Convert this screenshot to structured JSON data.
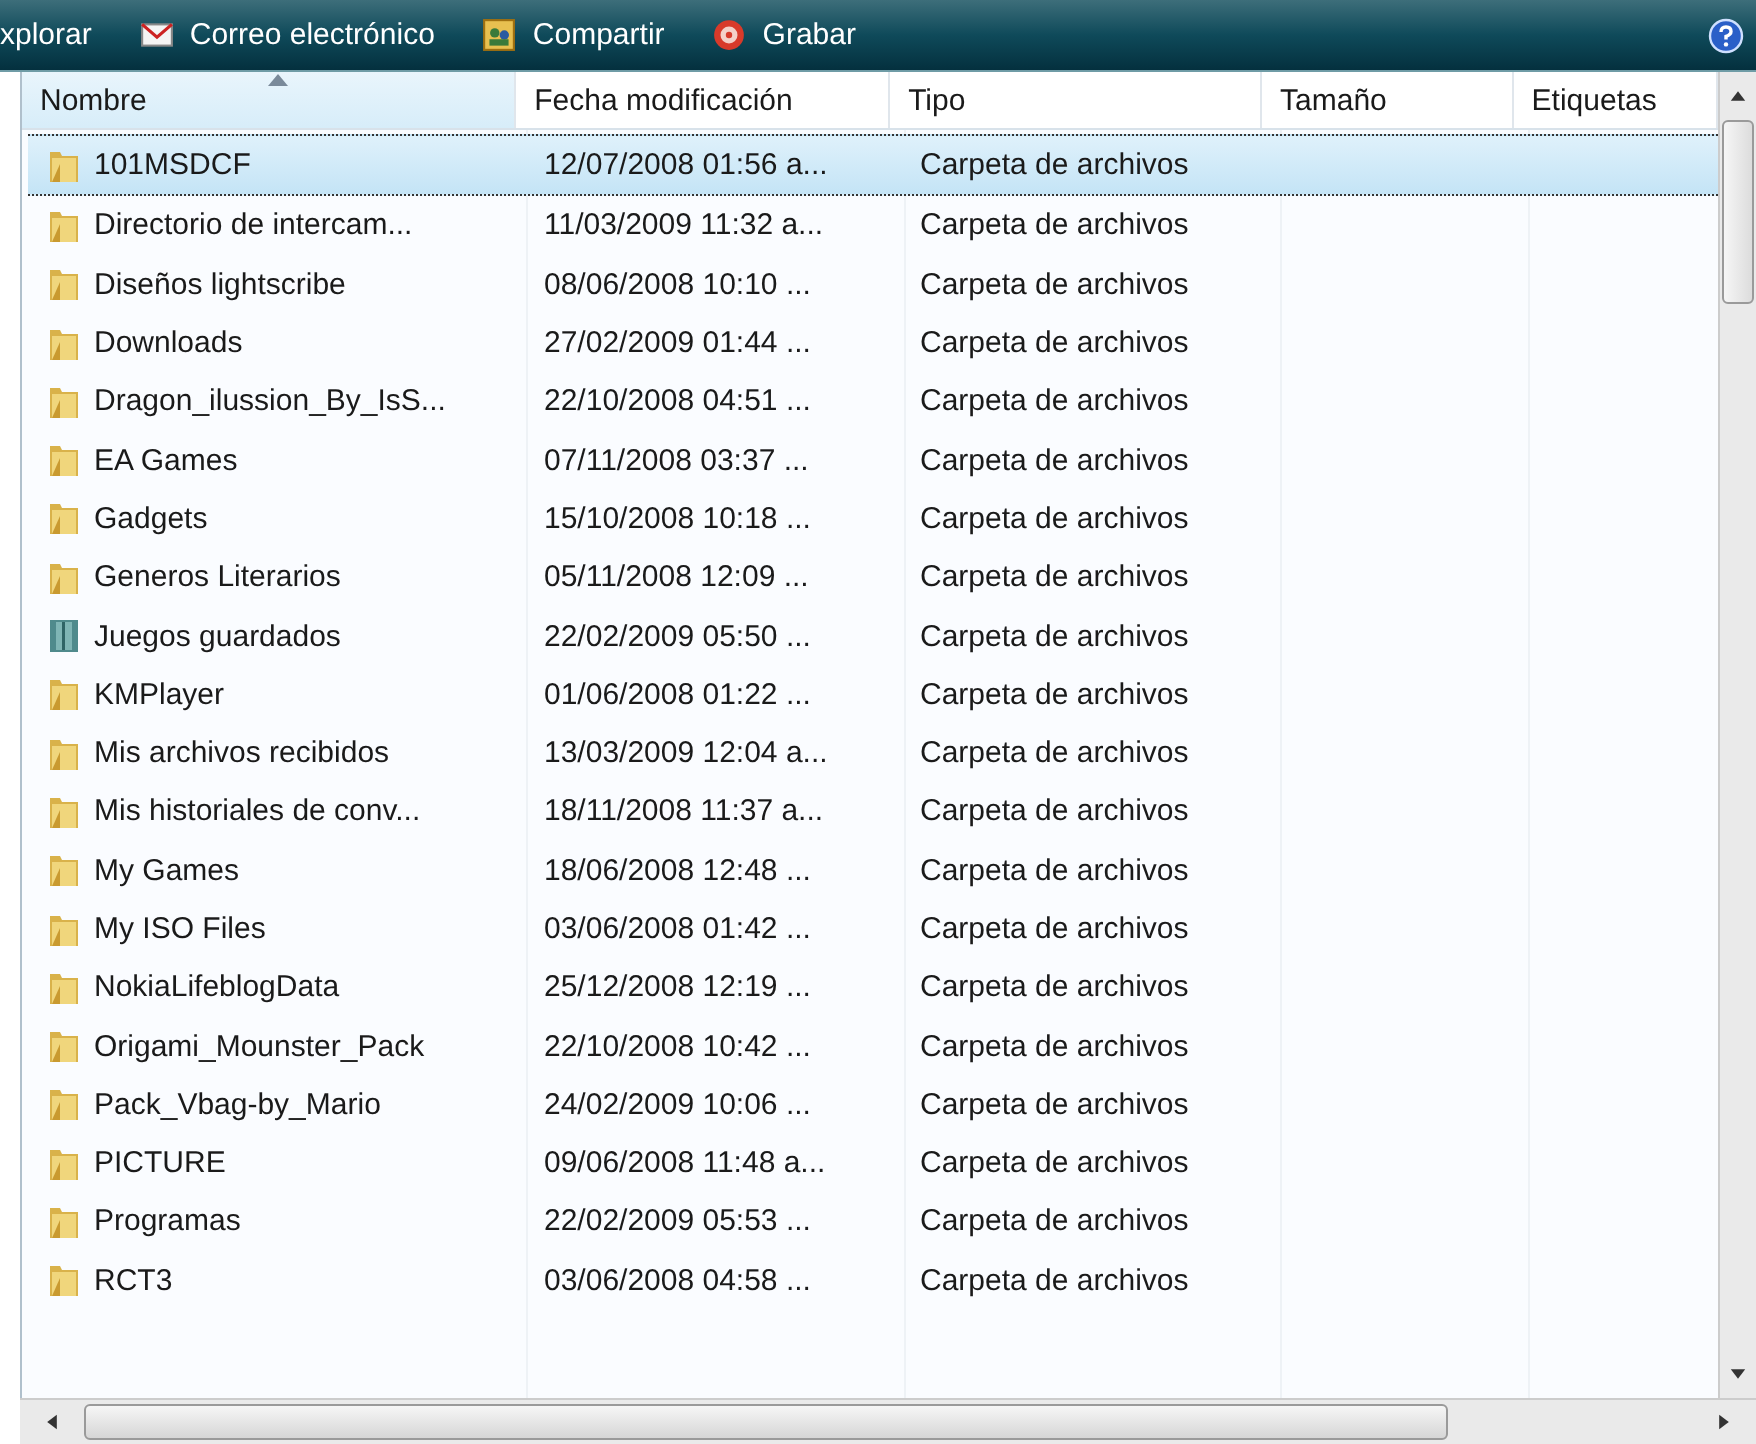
{
  "toolbar": {
    "items": [
      {
        "kind": "text",
        "label": "xplorar"
      },
      {
        "kind": "mail",
        "label": "Correo electrónico"
      },
      {
        "kind": "share",
        "label": "Compartir"
      },
      {
        "kind": "burn",
        "label": "Grabar"
      }
    ]
  },
  "table": {
    "columns": [
      {
        "label": "Nombre",
        "sorted": true
      },
      {
        "label": "Fecha modificación",
        "sorted": false
      },
      {
        "label": "Tipo",
        "sorted": false
      },
      {
        "label": "Tamaño",
        "sorted": false
      },
      {
        "label": "Etiquetas",
        "sorted": false
      }
    ],
    "rows": [
      {
        "kind": "folder",
        "name": "101MSDCF",
        "date": "12/07/2008 01:56 a...",
        "type": "Carpeta de archivos",
        "selected": true
      },
      {
        "kind": "folder",
        "name": "Directorio de intercam...",
        "date": "11/03/2009 11:32 a...",
        "type": "Carpeta de archivos",
        "selected": false
      },
      {
        "kind": "folder",
        "name": "Diseños lightscribe",
        "date": "08/06/2008 10:10 ...",
        "type": "Carpeta de archivos",
        "selected": false
      },
      {
        "kind": "folder",
        "name": "Downloads",
        "date": "27/02/2009 01:44 ...",
        "type": "Carpeta de archivos",
        "selected": false
      },
      {
        "kind": "folder",
        "name": "Dragon_ilussion_By_IsS...",
        "date": "22/10/2008 04:51 ...",
        "type": "Carpeta de archivos",
        "selected": false
      },
      {
        "kind": "folder",
        "name": "EA Games",
        "date": "07/11/2008 03:37 ...",
        "type": "Carpeta de archivos",
        "selected": false
      },
      {
        "kind": "folder",
        "name": "Gadgets",
        "date": "15/10/2008 10:18 ...",
        "type": "Carpeta de archivos",
        "selected": false
      },
      {
        "kind": "folder",
        "name": "Generos Literarios",
        "date": "05/11/2008 12:09 ...",
        "type": "Carpeta de archivos",
        "selected": false
      },
      {
        "kind": "games",
        "name": "Juegos guardados",
        "date": "22/02/2009 05:50 ...",
        "type": "Carpeta de archivos",
        "selected": false
      },
      {
        "kind": "folder",
        "name": "KMPlayer",
        "date": "01/06/2008 01:22 ...",
        "type": "Carpeta de archivos",
        "selected": false
      },
      {
        "kind": "folder",
        "name": "Mis archivos recibidos",
        "date": "13/03/2009 12:04 a...",
        "type": "Carpeta de archivos",
        "selected": false
      },
      {
        "kind": "folder",
        "name": "Mis historiales de conv...",
        "date": "18/11/2008 11:37 a...",
        "type": "Carpeta de archivos",
        "selected": false
      },
      {
        "kind": "folder",
        "name": "My Games",
        "date": "18/06/2008 12:48 ...",
        "type": "Carpeta de archivos",
        "selected": false
      },
      {
        "kind": "folder",
        "name": "My ISO Files",
        "date": "03/06/2008 01:42 ...",
        "type": "Carpeta de archivos",
        "selected": false
      },
      {
        "kind": "folder",
        "name": "NokiaLifeblogData",
        "date": "25/12/2008 12:19 ...",
        "type": "Carpeta de archivos",
        "selected": false
      },
      {
        "kind": "folder",
        "name": "Origami_Mounster_Pack",
        "date": "22/10/2008 10:42 ...",
        "type": "Carpeta de archivos",
        "selected": false
      },
      {
        "kind": "folder",
        "name": "Pack_Vbag-by_Mario",
        "date": "24/02/2009 10:06 ...",
        "type": "Carpeta de archivos",
        "selected": false
      },
      {
        "kind": "folder",
        "name": "PICTURE",
        "date": "09/06/2008 11:48 a...",
        "type": "Carpeta de archivos",
        "selected": false
      },
      {
        "kind": "folder",
        "name": "Programas",
        "date": "22/02/2009 05:53 ...",
        "type": "Carpeta de archivos",
        "selected": false
      },
      {
        "kind": "folder",
        "name": "RCT3",
        "date": "03/06/2008 04:58 ...",
        "type": "Carpeta de archivos",
        "selected": false
      }
    ]
  }
}
